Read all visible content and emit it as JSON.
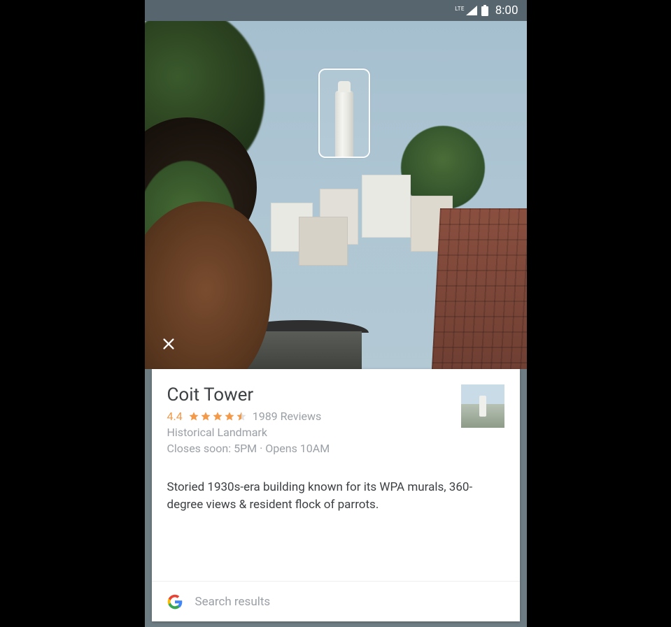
{
  "statusbar": {
    "network_label": "LTE",
    "time": "8:00"
  },
  "lens": {
    "icons": {
      "close": "close-icon"
    }
  },
  "result_card": {
    "title": "Coit Tower",
    "rating_value": "4.4",
    "reviews_text": "1989 Reviews",
    "category": "Historical Landmark",
    "hours_text": "Closes soon: 5PM · Opens 10AM",
    "description": "Storied 1930s-era building known for its WPA murals, 360-degree views & resident flock of parrots.",
    "search_results_label": "Search results",
    "colors": {
      "star": "#f2994a"
    }
  }
}
